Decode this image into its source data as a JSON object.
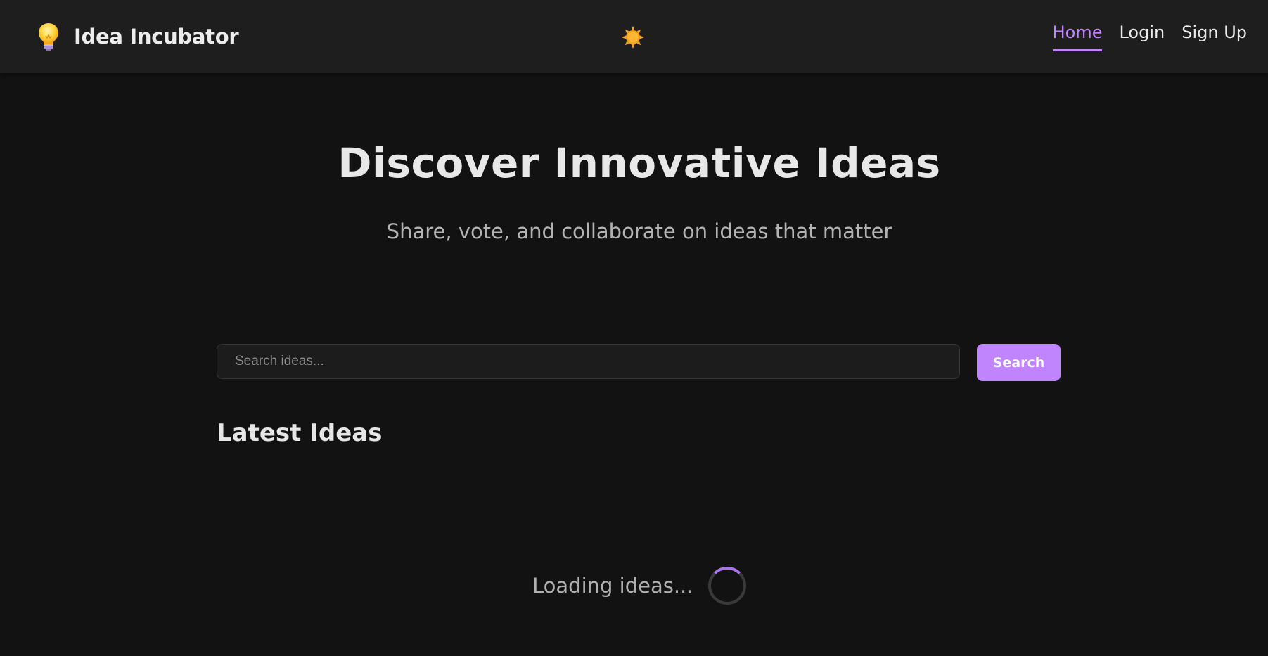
{
  "navbar": {
    "brand_name": "Idea Incubator",
    "brand_icon": "lightbulb-icon",
    "theme_toggle_icon": "sun-icon",
    "links": [
      {
        "label": "Home",
        "active": true
      },
      {
        "label": "Login",
        "active": false
      },
      {
        "label": "Sign Up",
        "active": false
      }
    ]
  },
  "hero": {
    "title": "Discover Innovative Ideas",
    "subtitle": "Share, vote, and collaborate on ideas that matter"
  },
  "search": {
    "placeholder": "Search ideas...",
    "value": "",
    "button_label": "Search"
  },
  "ideas": {
    "section_title": "Latest Ideas",
    "loading_text": "Loading ideas...",
    "loading_icon": "spinner-icon"
  },
  "colors": {
    "accent": "#c084fc",
    "background": "#121212",
    "navbar": "#1e1e1e"
  }
}
